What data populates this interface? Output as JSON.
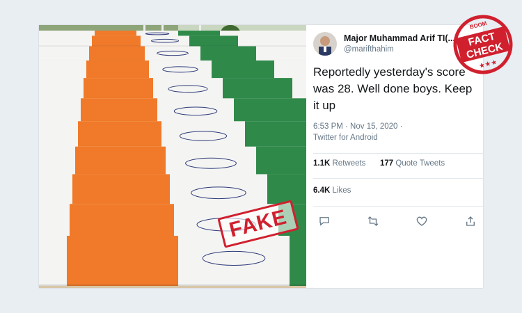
{
  "tweet": {
    "display_name": "Major Muhammad Arif TI(...",
    "handle": "@marifthahim",
    "text": "Reportedly yesterday's score was  28. Well done boys. Keep it up",
    "timestamp": "6:53 PM · Nov 15, 2020 ·",
    "source": "Twitter for Android",
    "retweets_count": "1.1K",
    "retweets_label": "Retweets",
    "quote_count": "177",
    "quote_label": "Quote Tweets",
    "likes_count": "6.4K",
    "likes_label": "Likes"
  },
  "actions": [
    {
      "icon": "reply-icon"
    },
    {
      "icon": "retweet-icon"
    },
    {
      "icon": "like-icon"
    },
    {
      "icon": "share-icon"
    }
  ],
  "overlay": {
    "fake_stamp": "FAKE",
    "badge_brand": "BOOM",
    "badge_line1": "FACT",
    "badge_line2": "CHECK"
  },
  "colors": {
    "saffron": "#f07a2a",
    "green": "#2f8a4a",
    "stamp_red": "#d0202e",
    "twitter_text": "#14171a",
    "twitter_muted": "#657786"
  }
}
